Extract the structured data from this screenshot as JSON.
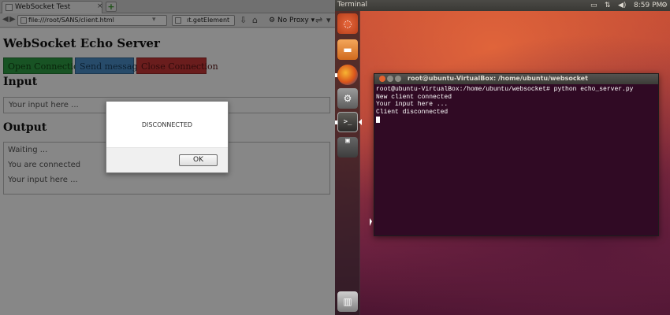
{
  "browser": {
    "tab_title": "WebSocket Test",
    "tab_close": "×",
    "new_tab": "+",
    "url": "file:///root/SANS/client.html",
    "search_value": "ıt.getElement",
    "proxy_label": "No Proxy",
    "page": {
      "title": "WebSocket Echo Server",
      "buttons": {
        "open": "Open Connection",
        "send": "Send message",
        "close": "Close Connection"
      },
      "input_heading": "Input",
      "input_placeholder": "Your input here ...",
      "output_heading": "Output",
      "output_lines": [
        "Waiting ...",
        "You are connected",
        "Your input here ..."
      ]
    },
    "dialog": {
      "message": "DISCONNECTED",
      "ok_label": "OK"
    }
  },
  "desktop": {
    "panel_title": "Terminal",
    "time": "8:59 PM",
    "launcher": {
      "terminal_glyph": ">_"
    },
    "terminal": {
      "window_title": "root@ubuntu-VirtualBox: /home/ubuntu/websocket",
      "lines": [
        "root@ubuntu-VirtualBox:/home/ubuntu/websocket# python echo_server.py",
        "New client connected",
        "Your input here ...",
        "Client disconnected"
      ]
    }
  }
}
